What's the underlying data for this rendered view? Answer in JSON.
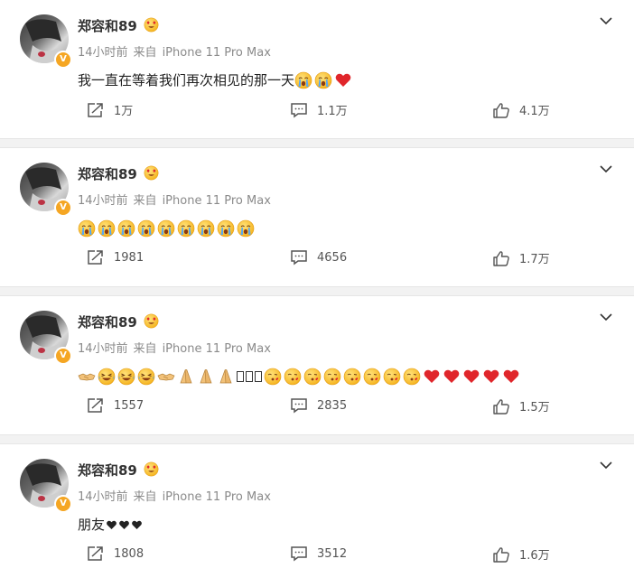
{
  "posts": [
    {
      "username": "郑容和89",
      "time": "14小时前",
      "source_prefix": "来自",
      "source": "iPhone 11 Pro Max",
      "text": "我一直在等着我们再次相见的那一天",
      "reposts": "1万",
      "comments": "1.1万",
      "likes": "4.1万"
    },
    {
      "username": "郑容和89",
      "time": "14小时前",
      "source_prefix": "来自",
      "source": "iPhone 11 Pro Max",
      "text": "",
      "reposts": "1981",
      "comments": "4656",
      "likes": "1.7万"
    },
    {
      "username": "郑容和89",
      "time": "14小时前",
      "source_prefix": "来自",
      "source": "iPhone 11 Pro Max",
      "text": "",
      "reposts": "1557",
      "comments": "2835",
      "likes": "1.5万"
    },
    {
      "username": "郑容和89",
      "time": "14小时前",
      "source_prefix": "来自",
      "source": "iPhone 11 Pro Max",
      "text": "朋友",
      "reposts": "1808",
      "comments": "3512",
      "likes": "1.6万"
    }
  ],
  "icons": {
    "verified_badge": "V",
    "username_emoji": "heart-eyes-emoji-icon",
    "expand": "chevron-down-icon",
    "repost": "repost-icon",
    "comment": "comment-icon",
    "like": "thumbs-up-icon"
  },
  "colors": {
    "verified": "#f5a623",
    "heart": "#e0262b",
    "emoji_yellow": "#ffc83d"
  }
}
